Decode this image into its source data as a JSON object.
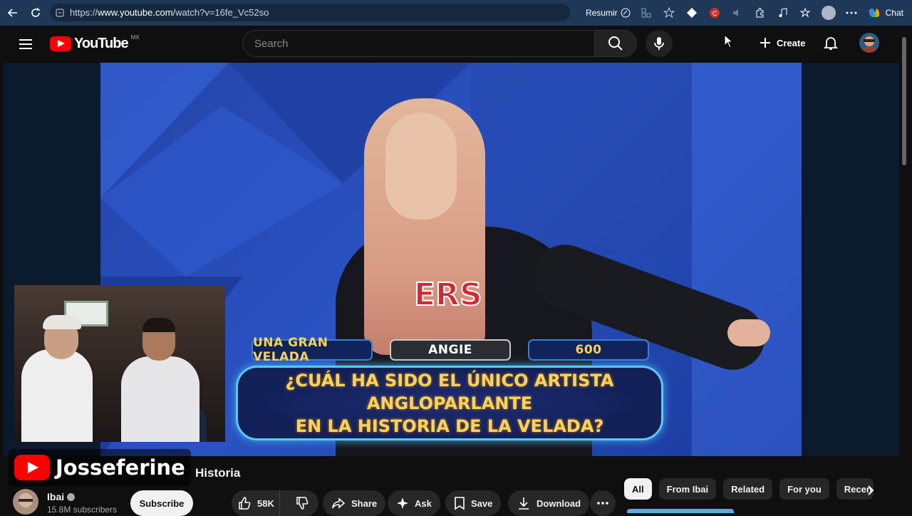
{
  "browser": {
    "url_prefix": "https://",
    "url_host": "www.youtube.com",
    "url_path": "/watch?v=16fe_Vc52so",
    "resumir_label": "Resumir",
    "chat_label": "Chat"
  },
  "header": {
    "logo_word": "YouTube",
    "logo_country": "MX",
    "search_placeholder": "Search",
    "create_label": "Create"
  },
  "video": {
    "tags": [
      "UNA GRAN VELADA",
      "ANGIE",
      "600"
    ],
    "question_line1": "¿CUÁL HA SIDO EL ÚNICO ARTISTA ANGLOPARLANTE",
    "question_line2": "EN LA HISTORIA DE LA VELADA?",
    "jersey_text": "ERS"
  },
  "overlay": {
    "streamer_name": "Josseferine"
  },
  "meta": {
    "title_fragment": "Historia",
    "channel_name": "Ibai",
    "subscribers": "15.8M subscribers",
    "subscribe_label": "Subscribe",
    "likes": "58K",
    "share_label": "Share",
    "ask_label": "Ask",
    "save_label": "Save",
    "download_label": "Download"
  },
  "chips": [
    "All",
    "From Ibai",
    "Related",
    "For you",
    "Recen"
  ],
  "colors": {
    "brand_red": "#ff0000",
    "tag_gold": "#f9d35a",
    "question_border": "#5fc6f2"
  }
}
